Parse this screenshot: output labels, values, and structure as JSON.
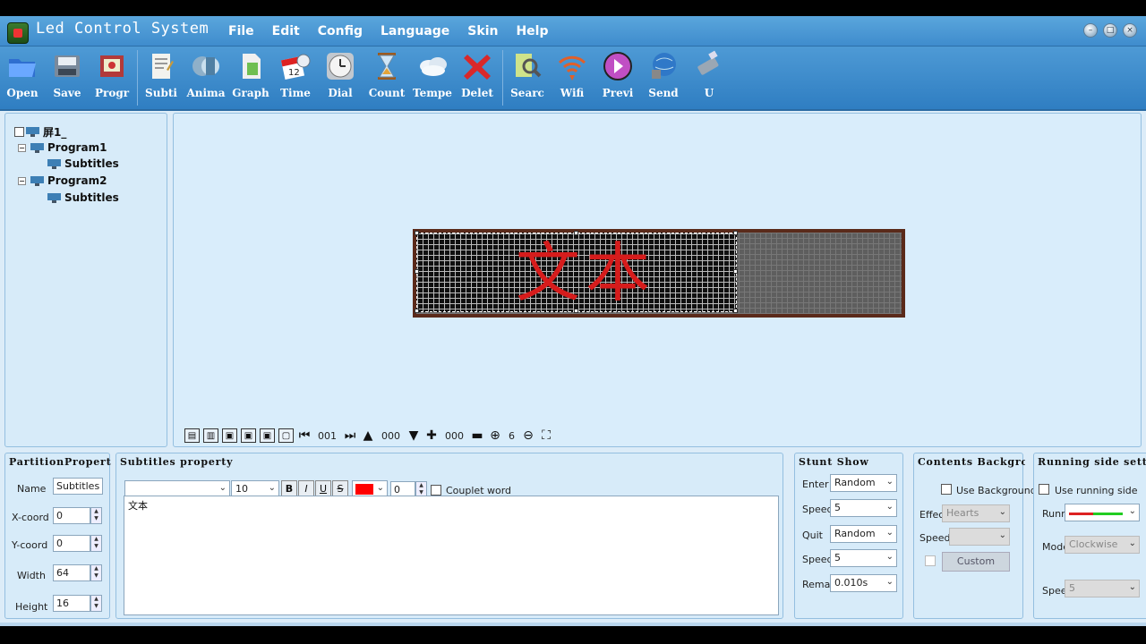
{
  "app": {
    "title": "Led Control System"
  },
  "menu": [
    "File",
    "Edit",
    "Config",
    "Language",
    "Skin",
    "Help"
  ],
  "toolbar": [
    {
      "label": "Open",
      "icon": "folder-icon"
    },
    {
      "label": "Save",
      "icon": "save-icon"
    },
    {
      "label": "Progr",
      "icon": "program-icon"
    },
    {
      "label": "Subti",
      "icon": "subtitle-icon"
    },
    {
      "label": "Anima",
      "icon": "animation-icon"
    },
    {
      "label": "Graph",
      "icon": "graphic-icon"
    },
    {
      "label": "Time",
      "icon": "calendar-icon"
    },
    {
      "label": "Dial",
      "icon": "clock-icon"
    },
    {
      "label": "Count",
      "icon": "hourglass-icon"
    },
    {
      "label": "Tempe",
      "icon": "cloud-icon"
    },
    {
      "label": "Delet",
      "icon": "delete-icon"
    },
    {
      "label": "Searc",
      "icon": "search-icon"
    },
    {
      "label": "Wifi",
      "icon": "wifi-icon"
    },
    {
      "label": "Previ",
      "icon": "preview-icon"
    },
    {
      "label": "Send",
      "icon": "send-icon"
    },
    {
      "label": "U",
      "icon": "usb-icon"
    }
  ],
  "tree": {
    "screen": "屏1_",
    "program1": "Program1",
    "program1_child": "Subtitles",
    "program2": "Program2",
    "program2_child": "Subtitles"
  },
  "led": {
    "text": "文本",
    "text_color": "#d61c1c"
  },
  "canvas_tools": {
    "page": "001",
    "layer": "000",
    "zoom_step": "000",
    "zoom": "6"
  },
  "partition": {
    "title": "PartitionProperties",
    "name_label": "Name",
    "name_value": "Subtitles",
    "x_label": "X-coord",
    "x_value": "0",
    "y_label": "Y-coord",
    "y_value": "0",
    "width_label": "Width",
    "width_value": "64",
    "height_label": "Height",
    "height_value": "16"
  },
  "subtitles": {
    "title": "Subtitles property",
    "font_size": "10",
    "bold": "B",
    "italic": "I",
    "underline": "U",
    "strike": "S",
    "color": "#ff0000",
    "spacing": "0",
    "couplet_label": "Couplet word",
    "content": "文本"
  },
  "stunt": {
    "title": "Stunt Show",
    "enter_label": "Enter",
    "enter_value": "Random",
    "speed1_label": "Speed",
    "speed1_value": "5",
    "quit_label": "Quit",
    "quit_value": "Random",
    "speed2_label": "Speed",
    "speed2_value": "5",
    "remain_label": "Remain",
    "remain_value": "0.010s"
  },
  "background": {
    "title": "Contents Background",
    "use_label": "Use Background",
    "effect_label": "Effect",
    "effect_value": "Hearts",
    "speed_label": "Speed",
    "custom_label": "Custom"
  },
  "running": {
    "title": "Running side setting",
    "use_label": "Use running side",
    "run_label": "Running",
    "mode_label": "Mode",
    "mode_value": "Clockwise",
    "speed_label": "Speed",
    "speed_value": "5"
  }
}
